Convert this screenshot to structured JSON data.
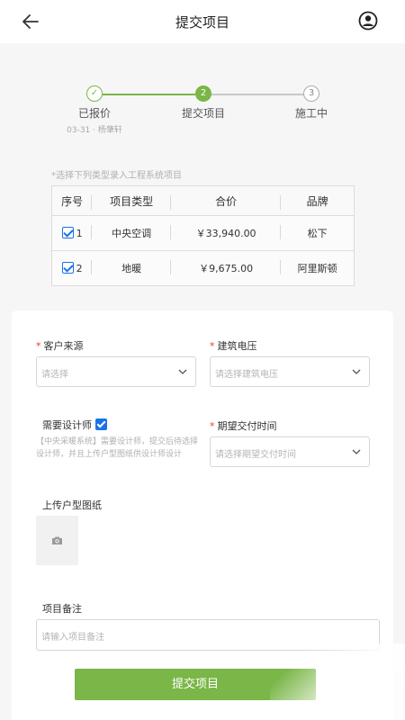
{
  "header": {
    "title": "提交项目",
    "back_icon": "arrow-left-icon",
    "profile_icon": "user-circle-icon"
  },
  "steps": [
    {
      "index": "✓",
      "label": "已报价",
      "sub": "03-31 · 杨肇轩",
      "state": "done"
    },
    {
      "index": "2",
      "label": "提交项目",
      "state": "active"
    },
    {
      "index": "3",
      "label": "施工中",
      "state": "pending"
    }
  ],
  "table": {
    "hint": "*选择下列类型录入工程系统项目",
    "headers": [
      "序号",
      "项目类型",
      "合价",
      "品牌"
    ],
    "rows": [
      {
        "seq": "1",
        "type": "中央空调",
        "price": "￥33,940.00",
        "brand": "松下",
        "checked": true
      },
      {
        "seq": "2",
        "type": "地暖",
        "price": "￥9,675.00",
        "brand": "阿里斯顿",
        "checked": true
      }
    ]
  },
  "form": {
    "customer_source": {
      "label": "客户来源",
      "placeholder": "请选择"
    },
    "voltage": {
      "label": "建筑电压",
      "placeholder": "请选择建筑电压"
    },
    "designer": {
      "label": "需要设计师",
      "checked": true,
      "note": "【中央采暖系统】需要设计师，提交后待选择设计师，并且上传户型图纸供设计师设计"
    },
    "delivery_time": {
      "label": "期望交付时间",
      "placeholder": "请选择期望交付时间"
    },
    "upload": {
      "label": "上传户型图纸",
      "icon": "camera-icon"
    },
    "remark": {
      "label": "项目备注",
      "placeholder": "请输入项目备注"
    },
    "submit_label": "提交项目"
  },
  "colors": {
    "accent": "#7ab648",
    "checkbox": "#1a73e8",
    "required": "#e53935"
  }
}
